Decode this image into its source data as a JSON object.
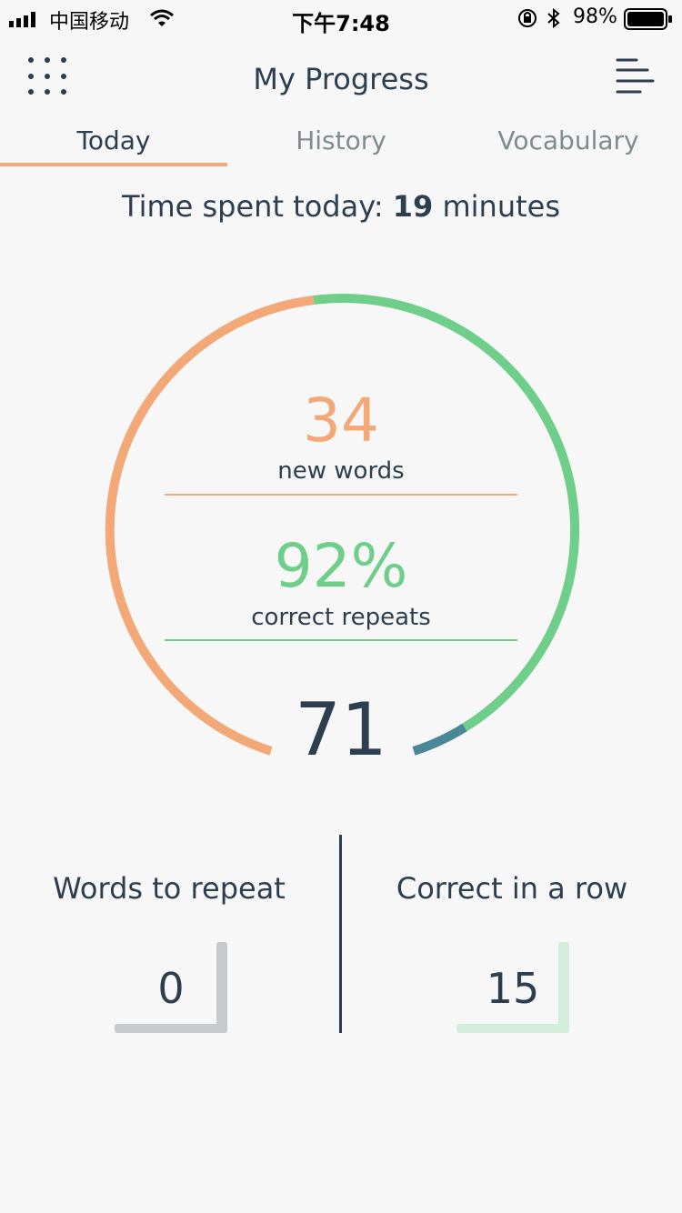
{
  "status_bar": {
    "carrier": "中国移动",
    "time": "下午7:48",
    "battery_pct": "98%"
  },
  "header": {
    "title": "My Progress",
    "left_icon": "grid-dots-icon",
    "right_icon": "menu-lines-icon"
  },
  "tabs": [
    {
      "label": "Today",
      "active": true
    },
    {
      "label": "History",
      "active": false
    },
    {
      "label": "Vocabulary",
      "active": false
    }
  ],
  "time_spent": {
    "prefix": "Time spent today: ",
    "value": "19",
    "suffix": " minutes"
  },
  "progress": {
    "new_words_value": "34",
    "new_words_label": "new words",
    "correct_value": "92%",
    "correct_label": "correct repeats",
    "total_value": "71"
  },
  "bottom": {
    "words_to_repeat_label": "Words to repeat",
    "words_to_repeat_value": "0",
    "correct_in_row_label": "Correct in a row",
    "correct_in_row_value": "15"
  },
  "colors": {
    "accent_orange": "#f3a977",
    "accent_green": "#6fcf8a",
    "accent_teal": "#4a8799",
    "text_dark": "#2c3e50",
    "counter_grey": "#c5cbcb",
    "counter_light_green": "#d2eedb"
  }
}
